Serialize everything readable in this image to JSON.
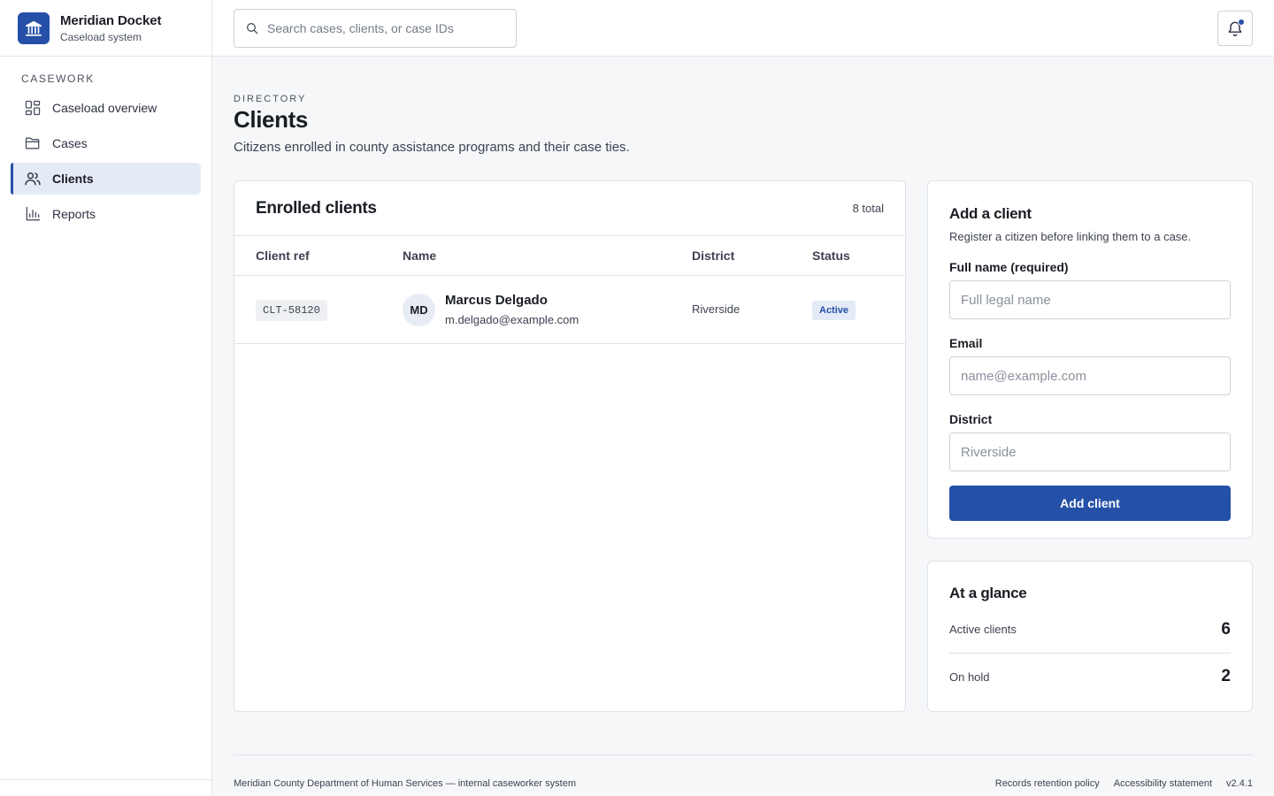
{
  "brand": {
    "name": "Meridian Docket",
    "subtitle": "Caseload system",
    "icon": "government-building-icon"
  },
  "search": {
    "placeholder": "Search cases, clients, or case IDs"
  },
  "sidebar": {
    "section_label": "CASEWORK",
    "items": [
      {
        "label": "Caseload overview",
        "icon": "dashboard-grid-icon",
        "active": false
      },
      {
        "label": "Cases",
        "icon": "folder-icon",
        "active": false
      },
      {
        "label": "Clients",
        "icon": "users-icon",
        "active": true
      },
      {
        "label": "Reports",
        "icon": "bar-chart-icon",
        "active": false
      }
    ]
  },
  "page": {
    "eyebrow": "DIRECTORY",
    "title": "Clients",
    "description": "Citizens enrolled in county assistance programs and their case ties."
  },
  "clients_table": {
    "title": "Enrolled clients",
    "count": "8 total",
    "columns": [
      "Client ref",
      "Name",
      "District",
      "Status"
    ],
    "rows": [
      {
        "ref": "CLT-58120",
        "initials": "MD",
        "name": "Marcus Delgado",
        "email": "m.delgado@example.com",
        "district": "Riverside",
        "status": "Active"
      }
    ]
  },
  "add_client": {
    "title": "Add a client",
    "subtitle": "Register a citizen before linking them to a case.",
    "fields": {
      "full_name": {
        "label": "Full name (required)",
        "placeholder": "Full legal name",
        "value": ""
      },
      "email": {
        "label": "Email",
        "placeholder": "name@example.com",
        "value": ""
      },
      "district": {
        "label": "District",
        "placeholder": "Riverside",
        "value": ""
      }
    },
    "submit_label": "Add client"
  },
  "at_a_glance": {
    "title": "At a glance",
    "stats": [
      {
        "label": "Active clients",
        "value": "6"
      },
      {
        "label": "On hold",
        "value": "2"
      }
    ]
  },
  "footer": {
    "left": "Meridian County Department of Human Services — internal caseworker system",
    "links": [
      "Records retention policy",
      "Accessibility statement"
    ],
    "version": "v2.4.1"
  },
  "colors": {
    "accent": "#2550a8",
    "active_nav_bg": "#e4eaf6",
    "page_bg": "#f6f7f9"
  }
}
